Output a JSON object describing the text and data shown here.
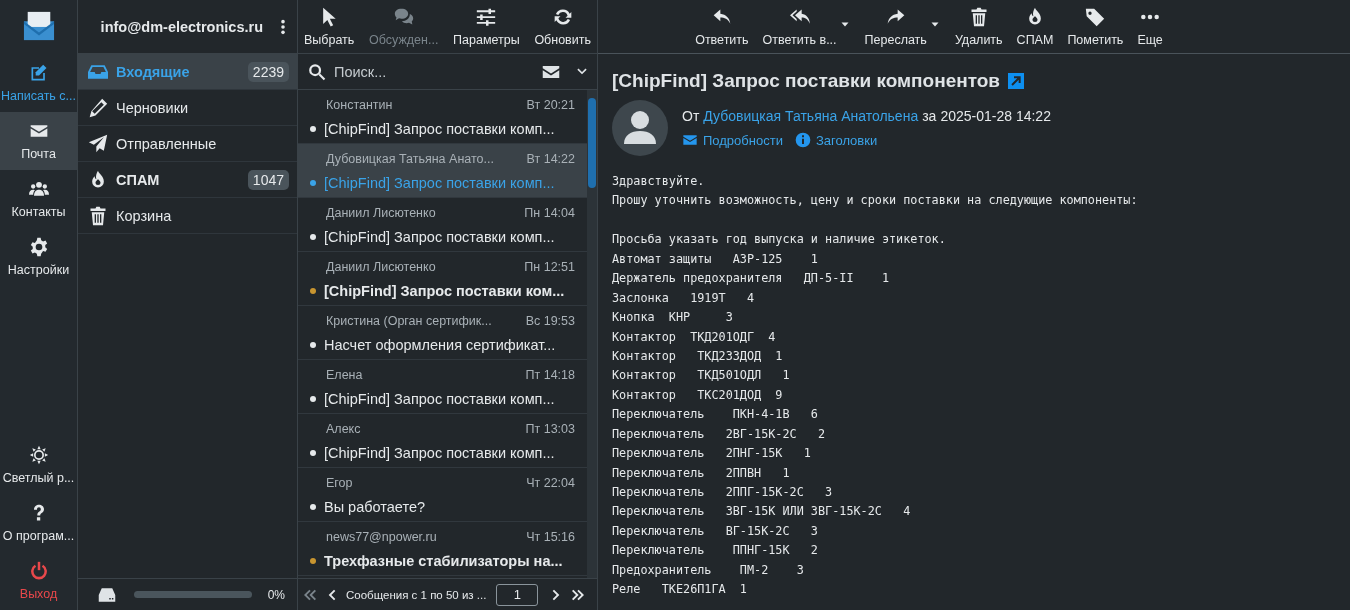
{
  "nav": {
    "items": [
      {
        "label": "Написать с...",
        "kind": "compose",
        "selected": false
      },
      {
        "label": "Почта",
        "kind": "normal",
        "selected": true
      },
      {
        "label": "Контакты",
        "kind": "normal",
        "selected": false
      },
      {
        "label": "Настройки",
        "kind": "normal",
        "selected": false
      }
    ],
    "bottom_items": [
      {
        "label": "Светлый р...",
        "kind": "normal"
      },
      {
        "label": "О програм...",
        "kind": "normal"
      },
      {
        "label": "Выход",
        "kind": "danger"
      }
    ]
  },
  "account": {
    "email": "info@dm-electronics.ru"
  },
  "folders": [
    {
      "name": "Входящие",
      "count": "2239",
      "selected": true,
      "unread": true
    },
    {
      "name": "Черновики",
      "selected": false,
      "unread": false
    },
    {
      "name": "Отправленные",
      "selected": false,
      "unread": false
    },
    {
      "name": "СПАМ",
      "count": "1047",
      "selected": false,
      "unread": true
    },
    {
      "name": "Корзина",
      "selected": false,
      "unread": false
    }
  ],
  "quota": {
    "level": 0,
    "reading": "0%"
  },
  "list_toolbar": [
    {
      "label": "Выбрать",
      "disabled": false
    },
    {
      "label": "Обсужден...",
      "disabled": true
    },
    {
      "label": "Параметры",
      "disabled": false
    },
    {
      "label": "Обновить",
      "disabled": false
    }
  ],
  "search": {
    "placeholder": "Поиск..."
  },
  "messages": [
    {
      "sender": "Константин",
      "date": "Вт 20:21",
      "subject": "[ChipFind] Запрос поставки комп...",
      "selected": false,
      "unread": false
    },
    {
      "sender": "Дубовицкая Татьяна Анато...",
      "date": "Вт 14:22",
      "subject": "[ChipFind] Запрос поставки комп...",
      "selected": true,
      "unread": false
    },
    {
      "sender": "Даниил Лисютенко",
      "date": "Пн 14:04",
      "subject": "[ChipFind] Запрос поставки комп...",
      "selected": false,
      "unread": false
    },
    {
      "sender": "Даниил Лисютенко",
      "date": "Пн 12:51",
      "subject": "[ChipFind] Запрос поставки ком...",
      "selected": false,
      "unread": true
    },
    {
      "sender": "Кристина (Орган сертифик...",
      "date": "Вс 19:53",
      "subject": "Насчет оформления сертификат...",
      "selected": false,
      "unread": false
    },
    {
      "sender": "Елена",
      "date": "Пт 14:18",
      "subject": "[ChipFind] Запрос поставки комп...",
      "selected": false,
      "unread": false
    },
    {
      "sender": "Алекс",
      "date": "Пт 13:03",
      "subject": "[ChipFind] Запрос поставки комп...",
      "selected": false,
      "unread": false
    },
    {
      "sender": "Егор",
      "date": "Чт 22:04",
      "subject": "Вы работаете?",
      "selected": false,
      "unread": false
    },
    {
      "sender": "news77@npower.ru",
      "date": "Чт 15:16",
      "subject": "Трехфазные стабилизаторы на...",
      "selected": false,
      "unread": true
    }
  ],
  "pager": {
    "text": "Сообщения с 1 по 50 из ...",
    "page": "1"
  },
  "message_toolbar": [
    {
      "label": "Ответить",
      "dropdown": false
    },
    {
      "label": "Ответить в...",
      "dropdown": true
    },
    {
      "label": "Переслать",
      "dropdown": true
    },
    {
      "label": "Удалить",
      "dropdown": false
    },
    {
      "label": "СПАМ",
      "dropdown": false
    },
    {
      "label": "Пометить",
      "dropdown": false
    },
    {
      "label": "Еще",
      "dropdown": false
    }
  ],
  "message": {
    "subject": "[ChipFind] Запрос поставки компонентов",
    "from_label": "От",
    "from": "Дубовицкая Татьяна Анатольена",
    "date_prefix": "за",
    "date": "2025-01-28 14:22",
    "links": [
      "Подробности",
      "Заголовки"
    ],
    "paragraphs": [
      [
        "Здравствуйте.",
        "Прошу уточнить возможность, цену и сроки поставки на следующие компоненты:"
      ],
      [
        "Просьба указать год выпуска и наличие этикеток.",
        "Автомат защиты   АЗР-125    1",
        "Держатель предохранителя   ДП-5-II    1",
        "Заслонка   1919T   4",
        "Кнопка  КНР     3",
        "Контактор  ТКД201ОДГ  4",
        "Контактор   ТКД233ДОД  1",
        "Контактор   ТКД501ОДЛ   1",
        "Контактор   ТКС201ДОД  9",
        "Переключатель    ПКН-4-1В   6",
        "Переключатель   2ВГ-15К-2С   2",
        "Переключатель   2ПНГ-15К   1",
        "Переключатель   2ППВН   1",
        "Переключатель   2ППГ-15К-2С   3",
        "Переключатель   3ВГ-15К ИЛИ 3ВГ-15К-2С   4",
        "Переключатель   ВГ-15К-2С   3",
        "Переключатель    ППНГ-15К   2",
        "Предохранитель    ПМ-2    3",
        "Реле   ТКЕ26П1ГА  1"
      ]
    ]
  }
}
